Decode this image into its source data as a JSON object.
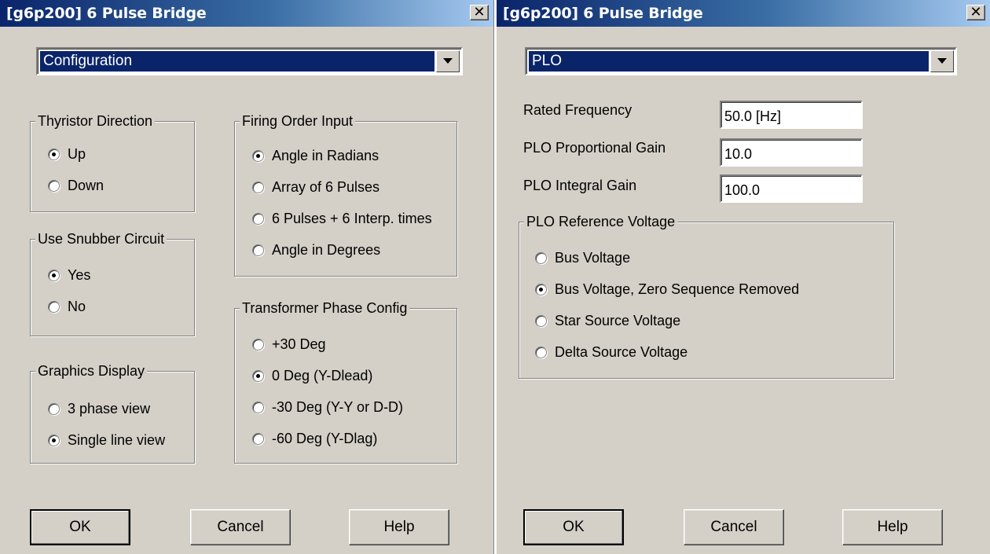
{
  "left_dialog": {
    "title": "[g6p200] 6 Pulse Bridge",
    "close_glyph": "✕",
    "category_select": "Configuration",
    "thyristor_direction": {
      "label": "Thyristor Direction",
      "options": [
        "Up",
        "Down"
      ],
      "selected": "Up"
    },
    "use_snubber_circuit": {
      "label": "Use Snubber Circuit",
      "options": [
        "Yes",
        "No"
      ],
      "selected": "Yes"
    },
    "graphics_display": {
      "label": "Graphics Display",
      "options": [
        "3 phase view",
        "Single line view"
      ],
      "selected": "Single line view"
    },
    "firing_order_input": {
      "label": "Firing Order Input",
      "options": [
        "Angle in Radians",
        "Array of 6 Pulses",
        "6 Pulses + 6 Interp. times",
        "Angle in Degrees"
      ],
      "selected": "Angle in Radians"
    },
    "transformer_phase_config": {
      "label": "Transformer Phase Config",
      "options": [
        "+30 Deg",
        "0 Deg (Y-Dlead)",
        "-30 Deg (Y-Y or D-D)",
        "-60 Deg (Y-Dlag)"
      ],
      "selected": "0 Deg (Y-Dlead)"
    },
    "buttons": {
      "ok": "OK",
      "cancel": "Cancel",
      "help": "Help"
    }
  },
  "right_dialog": {
    "title": "[g6p200] 6 Pulse Bridge",
    "close_glyph": "✕",
    "category_select": "PLO",
    "fields": {
      "rated_frequency": {
        "label": "Rated Frequency",
        "value": "50.0 [Hz]"
      },
      "plo_proportional_gain": {
        "label": "PLO Proportional Gain",
        "value": "10.0"
      },
      "plo_integral_gain": {
        "label": "PLO Integral Gain",
        "value": "100.0"
      }
    },
    "plo_reference_voltage": {
      "label": "PLO Reference Voltage",
      "options": [
        "Bus Voltage",
        "Bus Voltage, Zero Sequence Removed",
        "Star Source Voltage",
        "Delta Source Voltage"
      ],
      "selected": "Bus Voltage, Zero Sequence Removed"
    },
    "buttons": {
      "ok": "OK",
      "cancel": "Cancel",
      "help": "Help"
    }
  },
  "colors": {
    "dialog_bg": "#d4d0c8",
    "title_gradient_start": "#0a246a",
    "title_gradient_end": "#a6caf0",
    "selection_bg": "#0a246a"
  }
}
